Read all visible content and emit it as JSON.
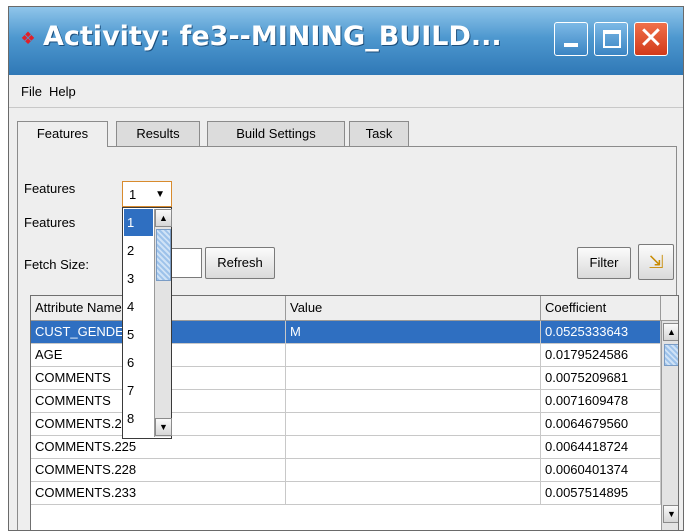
{
  "window": {
    "title": "Activity: fe3--MINING_BUILD...",
    "app_icon": "gem-icon",
    "controls": [
      "minimize-icon",
      "maximize-icon",
      "close-icon"
    ]
  },
  "menu": {
    "file": "File",
    "help": "Help"
  },
  "tabs": [
    {
      "label": "Features",
      "active": true
    },
    {
      "label": "Results",
      "active": false
    },
    {
      "label": "Build Settings",
      "active": false
    },
    {
      "label": "Task",
      "active": false
    }
  ],
  "form": {
    "features_label": "Features",
    "features_combo_value": "1",
    "features_label2": "Features",
    "fetch_size_label": "Fetch Size:",
    "fetch_size_value": "",
    "refresh_label": "Refresh",
    "filter_label": "Filter"
  },
  "dropdown": {
    "options": [
      "1",
      "2",
      "3",
      "4",
      "5",
      "6",
      "7",
      "8"
    ],
    "selected": "1"
  },
  "table": {
    "headers": [
      "Attribute Name",
      "Value",
      "Coefficient"
    ],
    "rows": [
      {
        "attr": "CUST_GENDER",
        "value": "M",
        "coef": "0.0525333643",
        "selected": true
      },
      {
        "attr": "AGE",
        "value": "",
        "coef": "0.0179524586"
      },
      {
        "attr": "COMMENTS",
        "value": "",
        "coef": "0.0075209681"
      },
      {
        "attr": "COMMENTS",
        "value": "",
        "coef": "0.0071609478"
      },
      {
        "attr": "COMMENTS.224",
        "value": "",
        "coef": "0.0064679560"
      },
      {
        "attr": "COMMENTS.225",
        "value": "",
        "coef": "0.0064418724"
      },
      {
        "attr": "COMMENTS.228",
        "value": "",
        "coef": "0.0060401374"
      },
      {
        "attr": "COMMENTS.233",
        "value": "",
        "coef": "0.0057514895"
      }
    ]
  },
  "colors": {
    "selection": "#2f6fc1",
    "title_bar": "#4e98cf",
    "close_button": "#d23a1a",
    "combo_focus_border": "#d88b2e"
  }
}
